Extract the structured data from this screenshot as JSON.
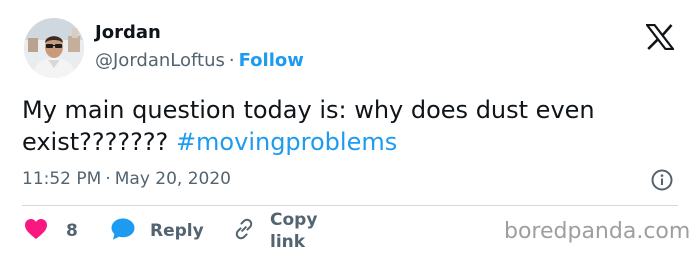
{
  "author": {
    "name": "Jordan",
    "handle": "@JordanLoftus",
    "separator": "·",
    "follow_label": "Follow"
  },
  "header": {
    "logo_icon": "x-logo-icon"
  },
  "tweet": {
    "text": "My main question today is: why does dust even exist???????",
    "hashtag": "#movingproblems"
  },
  "meta": {
    "time": "11:52 PM",
    "separator": "·",
    "date": "May 20, 2020",
    "info_icon": "info-icon"
  },
  "actions": {
    "like_count": "8",
    "reply_label": "Reply",
    "copy_label": "Copy link"
  },
  "watermark": "boredpanda.com",
  "colors": {
    "accent": "#1d9bf0",
    "heart": "#f91880",
    "text": "#0f1419",
    "muted": "#536471",
    "divider": "#cfd9de"
  }
}
